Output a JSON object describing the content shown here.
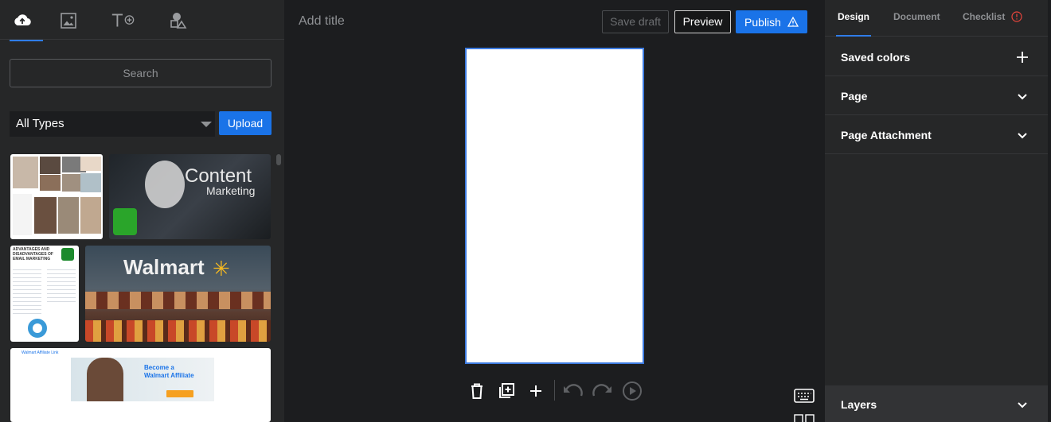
{
  "left_panel": {
    "tabs": [
      {
        "name": "upload-cloud-icon",
        "active": true
      },
      {
        "name": "image-icon",
        "active": false
      },
      {
        "name": "text-add-icon",
        "active": false
      },
      {
        "name": "shapes-icon",
        "active": false
      }
    ],
    "search": {
      "placeholder": "Search"
    },
    "type_filter": {
      "selected": "All Types"
    },
    "upload_label": "Upload",
    "thumbnails": [
      {
        "name": "thumb-collage"
      },
      {
        "name": "thumb-content-marketing",
        "text_main": "Content",
        "text_sub": "Marketing"
      },
      {
        "name": "thumb-email-marketing-doc",
        "heading": "ADVANTAGES AND DISADVANTAGES OF EMAIL MARKETING"
      },
      {
        "name": "thumb-walmart-store",
        "text": "Walmart"
      },
      {
        "name": "thumb-walmart-affiliate",
        "headline_1": "Become a",
        "headline_2": "Walmart Affiliate",
        "header": "Walmart Affiliate Link"
      }
    ]
  },
  "editor": {
    "title": {
      "placeholder": "Add title"
    },
    "save_draft_label": "Save draft",
    "preview_label": "Preview",
    "publish_label": "Publish"
  },
  "right_panel": {
    "tabs": [
      {
        "label": "Design",
        "active": true
      },
      {
        "label": "Document",
        "active": false
      },
      {
        "label": "Checklist",
        "active": false
      }
    ],
    "sections": {
      "saved_colors": "Saved colors",
      "page": "Page",
      "page_attachment": "Page Attachment",
      "layers": "Layers"
    }
  },
  "colors": {
    "accent": "#1a73e8",
    "panel": "#262728",
    "workspace": "#1c1d1f",
    "warning": "#e8453c"
  }
}
